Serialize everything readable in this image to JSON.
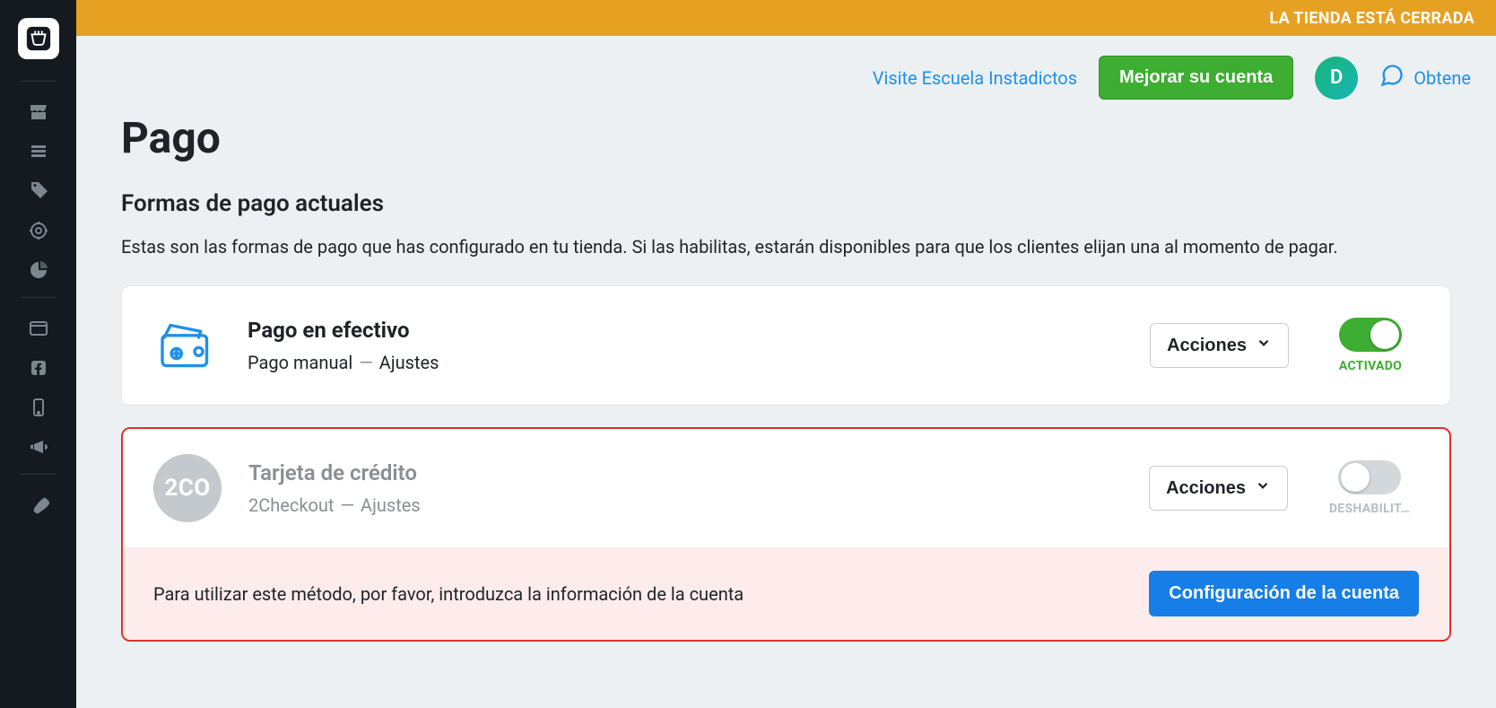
{
  "store_closed_banner": "LA TIENDA ESTÁ CERRADA",
  "header": {
    "visit_link": "Visite Escuela Instadictos",
    "upgrade_label": "Mejorar su cuenta",
    "avatar_initial": "D",
    "help_label": "Obtene"
  },
  "page": {
    "title": "Pago",
    "section_title": "Formas de pago actuales",
    "section_desc": "Estas son las formas de pago que has configurado en tu tienda. Si las habilitas, estarán disponibles para que los clientes elijan una al momento de pagar."
  },
  "methods": [
    {
      "icon": "wallet",
      "title": "Pago en efectivo",
      "provider": "Pago manual",
      "separator": "—",
      "settings_label": "Ajustes",
      "actions_label": "Acciones",
      "enabled": true,
      "toggle_label": "ACTIVADO"
    },
    {
      "icon": "2co",
      "icon_text": "2CO",
      "title": "Tarjeta de crédito",
      "provider": "2Checkout",
      "separator": "—",
      "settings_label": "Ajustes",
      "actions_label": "Acciones",
      "enabled": false,
      "toggle_label": "DESHABILIT…",
      "warning_text": "Para utilizar este método, por favor, introduzca la información de la cuenta",
      "config_button": "Configuración de la cuenta"
    }
  ]
}
